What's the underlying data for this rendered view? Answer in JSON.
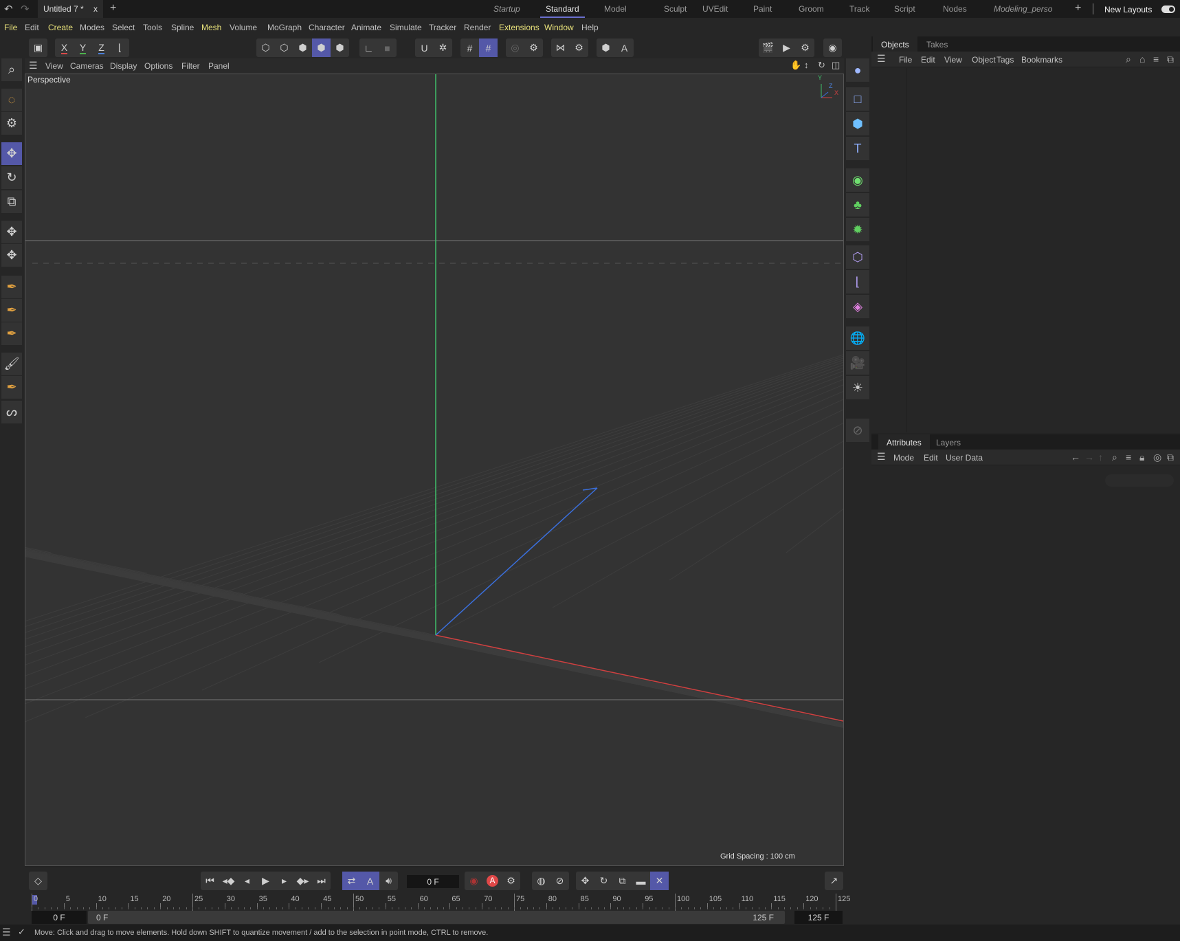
{
  "titlebar": {
    "doc_tab": "Untitled 7 *",
    "close": "x",
    "add": "+",
    "layouts": [
      {
        "label": "Startup",
        "italic": true
      },
      {
        "label": "Standard",
        "active": true
      },
      {
        "label": "Model"
      },
      {
        "label": "Sculpt"
      },
      {
        "label": "UVEdit"
      },
      {
        "label": "Paint"
      },
      {
        "label": "Groom"
      },
      {
        "label": "Track"
      },
      {
        "label": "Script"
      },
      {
        "label": "Nodes"
      },
      {
        "label": "Modeling_perso",
        "italic": true
      }
    ],
    "add_layout": "+",
    "new_layouts": "New Layouts"
  },
  "menubar": [
    "File",
    "Edit",
    "Create",
    "Modes",
    "Select",
    "Tools",
    "Spline",
    "Mesh",
    "Volume",
    "MoGraph",
    "Character",
    "Animate",
    "Simulate",
    "Tracker",
    "Render",
    "Extensions",
    "Window",
    "Help"
  ],
  "menubar_highlighted": [
    "File",
    "Create",
    "Mesh",
    "Extensions",
    "Window"
  ],
  "toolbar": {
    "x": "X",
    "y": "Y",
    "z": "Z",
    "axis_colors": {
      "x": "#d94a4a",
      "y": "#4cb34c",
      "z": "#4a7fd9"
    },
    "accent": "#5458a8"
  },
  "viewport": {
    "menu": [
      "View",
      "Cameras",
      "Display",
      "Options",
      "Filter",
      "Panel"
    ],
    "label": "Perspective",
    "grid_spacing": "Grid Spacing : 100 cm",
    "axis_y": "Y",
    "axis_z": "Z",
    "axis_x": "X"
  },
  "objects_panel": {
    "tabs": [
      "Objects",
      "Takes"
    ],
    "menu": [
      "File",
      "Edit",
      "View",
      "Object",
      "Tags",
      "Bookmarks"
    ]
  },
  "attributes_panel": {
    "tabs": [
      "Attributes",
      "Layers"
    ],
    "menu": [
      "Mode",
      "Edit",
      "User Data"
    ]
  },
  "timeline": {
    "current_frame": "0 F",
    "ticks": [
      "0",
      "5",
      "10",
      "15",
      "20",
      "25",
      "30",
      "35",
      "40",
      "45",
      "50",
      "55",
      "60",
      "65",
      "70",
      "75",
      "80",
      "85",
      "90",
      "95",
      "100",
      "105",
      "110",
      "115",
      "120",
      "125"
    ],
    "start": "0 F",
    "range_start": "0 F",
    "range_end": "125 F",
    "end": "125 F"
  },
  "status": {
    "message": "Move: Click and drag to move elements. Hold down SHIFT to quantize movement / add to the selection in point mode, CTRL to remove."
  }
}
